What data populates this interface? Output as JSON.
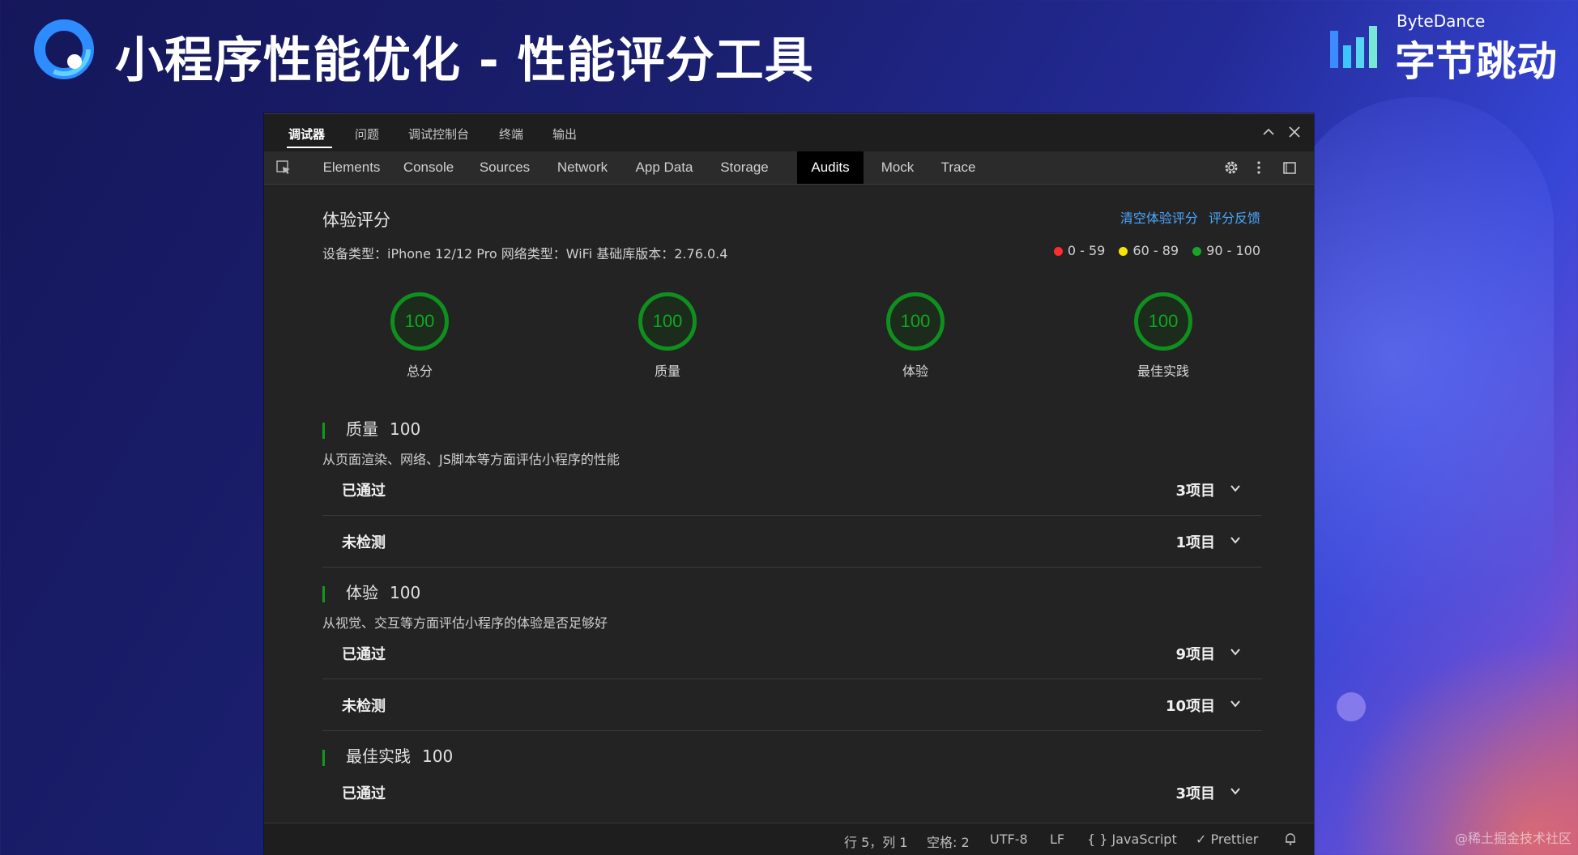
{
  "slide": {
    "title": "小程序性能优化 - 性能评分工具",
    "brand_en": "ByteDance",
    "brand_cn": "字节跳动",
    "credit": "@稀土掘金技术社区"
  },
  "devtools": {
    "top_tabs": [
      {
        "label": "调试器",
        "active": true
      },
      {
        "label": "问题",
        "active": false
      },
      {
        "label": "调试控制台",
        "active": false
      },
      {
        "label": "终端",
        "active": false
      },
      {
        "label": "输出",
        "active": false
      }
    ],
    "window_buttons": {
      "collapse": "^",
      "close": "✕"
    },
    "tabs": [
      {
        "label": "Elements",
        "active": false
      },
      {
        "label": "Console",
        "active": false
      },
      {
        "label": "Sources",
        "active": false
      },
      {
        "label": "Network",
        "active": false
      },
      {
        "label": "App Data",
        "active": false
      },
      {
        "label": "Storage",
        "active": false
      },
      {
        "label": "Audits",
        "active": true
      },
      {
        "label": "Mock",
        "active": false
      },
      {
        "label": "Trace",
        "active": false
      }
    ],
    "audit": {
      "title": "体验评分",
      "actions": [
        "清空体验评分",
        "评分反馈"
      ],
      "device_info": "设备类型：iPhone 12/12 Pro  网络类型：WiFi  基础库版本：2.76.0.4",
      "legend": [
        {
          "range": "0 - 59",
          "color": "#ff2d2d"
        },
        {
          "range": "60 - 89",
          "color": "#f6e500"
        },
        {
          "range": "90 - 100",
          "color": "#18a428"
        }
      ],
      "gauges": [
        {
          "score": "100",
          "label": "总分"
        },
        {
          "score": "100",
          "label": "质量"
        },
        {
          "score": "100",
          "label": "体验"
        },
        {
          "score": "100",
          "label": "最佳实践"
        }
      ],
      "sections": [
        {
          "name": "质量",
          "score": "100",
          "desc": "从页面渲染、网络、JS脚本等方面评估小程序的性能",
          "rows": [
            {
              "label": "已通过",
              "count": "3项目"
            },
            {
              "label": "未检测",
              "count": "1项目"
            }
          ]
        },
        {
          "name": "体验",
          "score": "100",
          "desc": "从视觉、交互等方面评估小程序的体验是否足够好",
          "rows": [
            {
              "label": "已通过",
              "count": "9项目"
            },
            {
              "label": "未检测",
              "count": "10项目"
            }
          ]
        },
        {
          "name": "最佳实践",
          "score": "100",
          "desc": "",
          "rows": [
            {
              "label": "已通过",
              "count": "3项目"
            }
          ]
        }
      ]
    },
    "statusbar": {
      "position": "行 5，列 1",
      "indent": "空格: 2",
      "encoding": "UTF-8",
      "eol": "LF",
      "language": "{ } JavaScript",
      "formatter": "✓ Prettier"
    },
    "icons": {
      "inspect": "inspect-icon",
      "settings": "gear-icon",
      "more": "more-vertical-icon",
      "dock": "dock-icon",
      "chevron": "chevron-down-icon",
      "bell": "bell-icon"
    },
    "accent_green": "#0f8f1e",
    "link_blue": "#4aa8ff"
  }
}
